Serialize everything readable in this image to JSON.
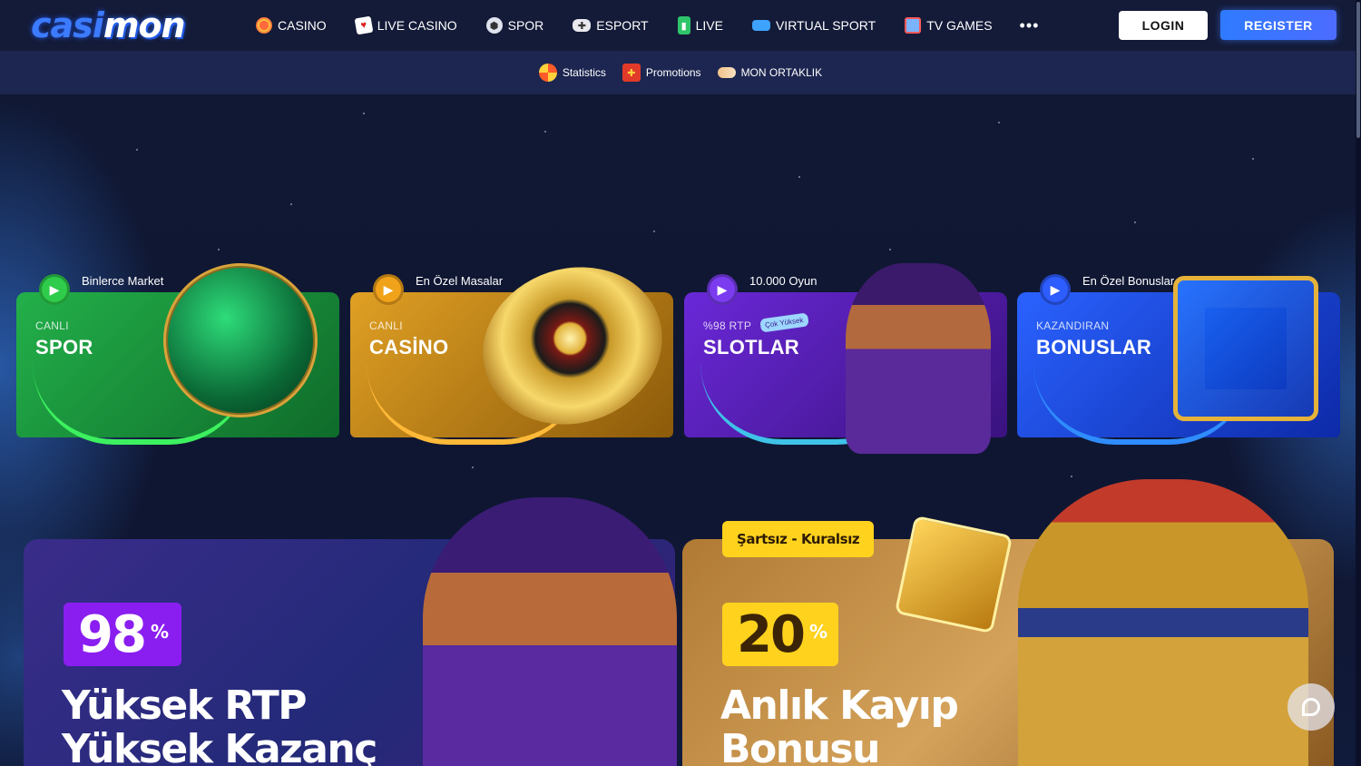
{
  "brand": {
    "logo_part1": "casi",
    "logo_part2": "mon"
  },
  "topnav": {
    "items": [
      {
        "label": "CASINO",
        "icon": "lollipop-icon"
      },
      {
        "label": "LIVE CASINO",
        "icon": "cards-icon"
      },
      {
        "label": "SPOR",
        "icon": "soccer-ball-icon"
      },
      {
        "label": "ESPORT",
        "icon": "gamepad-icon"
      },
      {
        "label": "LIVE",
        "icon": "ticket-icon"
      },
      {
        "label": "VIRTUAL SPORT",
        "icon": "vr-headset-icon"
      },
      {
        "label": "TV GAMES",
        "icon": "tv-icon"
      }
    ],
    "more": "•••",
    "login": "LOGIN",
    "register": "REGISTER"
  },
  "subnav": {
    "items": [
      {
        "label": "Statistics",
        "icon": "wheel-icon"
      },
      {
        "label": "Promotions",
        "icon": "gift-icon"
      },
      {
        "label": "MON ORTAKLIK",
        "icon": "handshake-icon"
      }
    ]
  },
  "cards": [
    {
      "tagline": "Binlerce Market",
      "small": "CANLI",
      "big": "SPOR",
      "color": "#1f9a3a"
    },
    {
      "tagline": "En Özel Masalar",
      "small": "CANLI",
      "big": "CASİNO",
      "color": "#c98412"
    },
    {
      "tagline": "10.000 Oyun",
      "small": "%98 RTP",
      "big": "SLOTLAR",
      "badge": "Çok Yüksek",
      "color": "#5a1fc0"
    },
    {
      "tagline": "En Özel Bonuslar",
      "small": "KAZANDIRAN",
      "big": "BONUSLAR",
      "color": "#1f4fe0"
    }
  ],
  "promos": [
    {
      "pct": "98",
      "pct_sign": "%",
      "headline_line1": "Yüksek RTP",
      "headline_line2": "Yüksek Kazanç"
    },
    {
      "chip": "Şartsız - Kuralsız",
      "pct": "20",
      "pct_sign": "%",
      "headline_line1": "Anlık Kayıp",
      "headline_line2": "Bonusu"
    }
  ]
}
